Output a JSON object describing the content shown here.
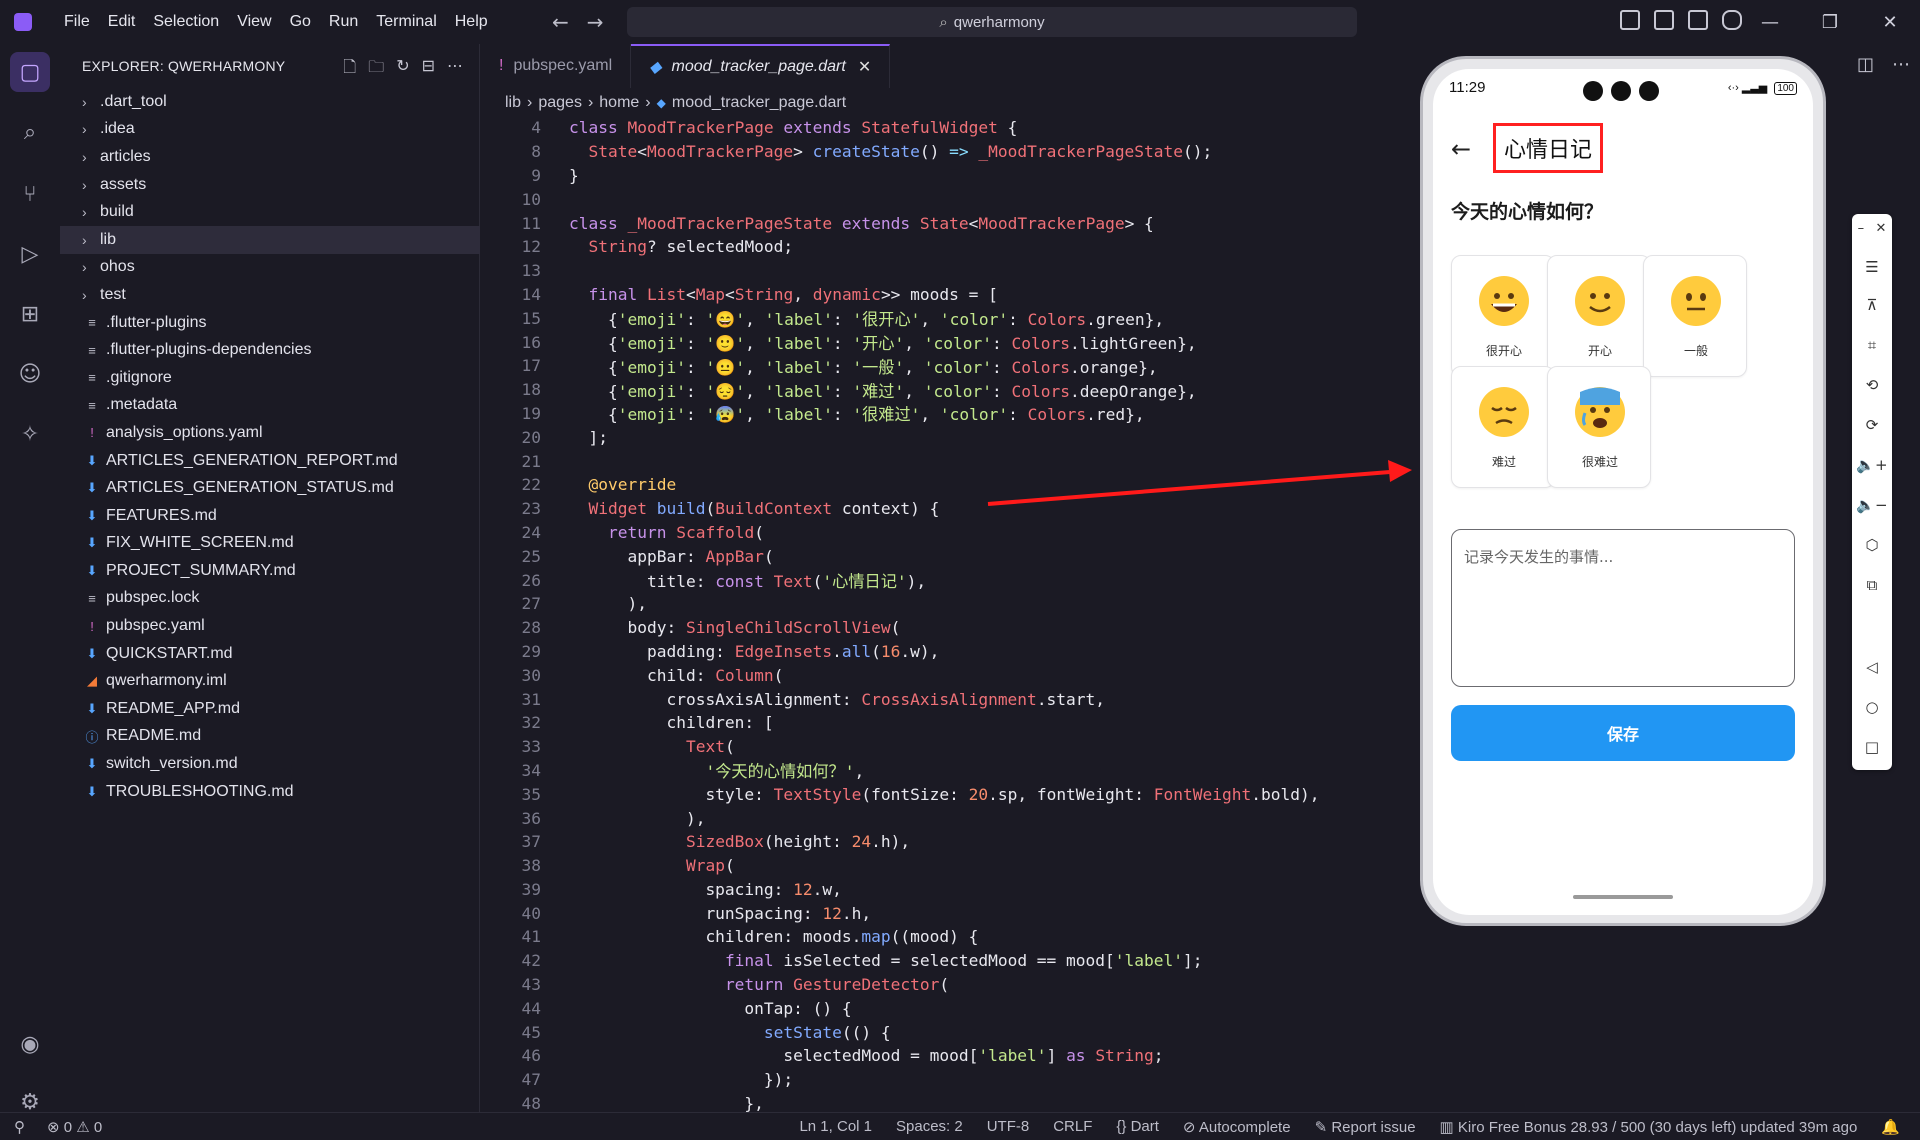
{
  "menu": [
    "File",
    "Edit",
    "Selection",
    "View",
    "Go",
    "Run",
    "Terminal",
    "Help"
  ],
  "search": {
    "label": "qwerharmony"
  },
  "explorer": {
    "title": "EXPLORER: QWERHARMONY",
    "items": [
      {
        "label": ".dart_tool",
        "kind": "folder"
      },
      {
        "label": ".idea",
        "kind": "folder"
      },
      {
        "label": "articles",
        "kind": "folder"
      },
      {
        "label": "assets",
        "kind": "folder"
      },
      {
        "label": "build",
        "kind": "folder"
      },
      {
        "label": "lib",
        "kind": "folder",
        "selected": true
      },
      {
        "label": "ohos",
        "kind": "folder"
      },
      {
        "label": "test",
        "kind": "folder"
      },
      {
        "label": ".flutter-plugins",
        "kind": "txt"
      },
      {
        "label": ".flutter-plugins-dependencies",
        "kind": "txt"
      },
      {
        "label": ".gitignore",
        "kind": "txt"
      },
      {
        "label": ".metadata",
        "kind": "txt"
      },
      {
        "label": "analysis_options.yaml",
        "kind": "yaml"
      },
      {
        "label": "ARTICLES_GENERATION_REPORT.md",
        "kind": "md"
      },
      {
        "label": "ARTICLES_GENERATION_STATUS.md",
        "kind": "md"
      },
      {
        "label": "FEATURES.md",
        "kind": "md"
      },
      {
        "label": "FIX_WHITE_SCREEN.md",
        "kind": "md"
      },
      {
        "label": "PROJECT_SUMMARY.md",
        "kind": "md"
      },
      {
        "label": "pubspec.lock",
        "kind": "txt"
      },
      {
        "label": "pubspec.yaml",
        "kind": "yaml"
      },
      {
        "label": "QUICKSTART.md",
        "kind": "md"
      },
      {
        "label": "qwerharmony.iml",
        "kind": "rss"
      },
      {
        "label": "README_APP.md",
        "kind": "md"
      },
      {
        "label": "README.md",
        "kind": "info"
      },
      {
        "label": "switch_version.md",
        "kind": "md"
      },
      {
        "label": "TROUBLESHOOTING.md",
        "kind": "md"
      }
    ]
  },
  "tabs": [
    {
      "label": "pubspec.yaml",
      "active": false
    },
    {
      "label": "mood_tracker_page.dart",
      "active": true
    }
  ],
  "breadcrumb": [
    "lib",
    "pages",
    "home",
    "mood_tracker_page.dart"
  ],
  "code": [
    {
      "n": "4",
      "html": "<span class='k'>class</span> <span class='t'>MoodTrackerPage</span> <span class='k'>extends</span> <span class='t'>StatefulWidget</span> {"
    },
    {
      "n": "8",
      "html": "  <span class='t'>State</span>&lt;<span class='t'>MoodTrackerPage</span>&gt; <span class='f'>createState</span>() <span class='p'>=&gt;</span> <span class='t'>_MoodTrackerPageState</span>();"
    },
    {
      "n": "9",
      "html": "}"
    },
    {
      "n": "10",
      "html": ""
    },
    {
      "n": "11",
      "html": "<span class='k'>class</span> <span class='t'>_MoodTrackerPageState</span> <span class='k'>extends</span> <span class='t'>State</span>&lt;<span class='t'>MoodTrackerPage</span>&gt; {"
    },
    {
      "n": "12",
      "html": "  <span class='t'>String</span>? selectedMood;"
    },
    {
      "n": "13",
      "html": ""
    },
    {
      "n": "14",
      "html": "  <span class='k'>final</span> <span class='t'>List</span>&lt;<span class='t'>Map</span>&lt;<span class='t'>String</span>, <span class='t'>dynamic</span>&gt;&gt; moods = ["
    },
    {
      "n": "15",
      "html": "    {<span class='s'>'emoji'</span>: <span class='s'>'😄'</span>, <span class='s'>'label'</span>: <span class='s'>'很开心'</span>, <span class='s'>'color'</span>: <span class='t'>Colors</span>.green},"
    },
    {
      "n": "16",
      "html": "    {<span class='s'>'emoji'</span>: <span class='s'>'🙂'</span>, <span class='s'>'label'</span>: <span class='s'>'开心'</span>, <span class='s'>'color'</span>: <span class='t'>Colors</span>.lightGreen},"
    },
    {
      "n": "17",
      "html": "    {<span class='s'>'emoji'</span>: <span class='s'>'😐'</span>, <span class='s'>'label'</span>: <span class='s'>'一般'</span>, <span class='s'>'color'</span>: <span class='t'>Colors</span>.orange},"
    },
    {
      "n": "18",
      "html": "    {<span class='s'>'emoji'</span>: <span class='s'>'😔'</span>, <span class='s'>'label'</span>: <span class='s'>'难过'</span>, <span class='s'>'color'</span>: <span class='t'>Colors</span>.deepOrange},"
    },
    {
      "n": "19",
      "html": "    {<span class='s'>'emoji'</span>: <span class='s'>'😰'</span>, <span class='s'>'label'</span>: <span class='s'>'很难过'</span>, <span class='s'>'color'</span>: <span class='t'>Colors</span>.red},"
    },
    {
      "n": "20",
      "html": "  ];"
    },
    {
      "n": "21",
      "html": ""
    },
    {
      "n": "22",
      "html": "  <span class='a'>@override</span>"
    },
    {
      "n": "23",
      "html": "  <span class='t'>Widget</span> <span class='f'>build</span>(<span class='t'>BuildContext</span> context) {"
    },
    {
      "n": "24",
      "html": "    <span class='k'>return</span> <span class='t'>Scaffold</span>("
    },
    {
      "n": "25",
      "html": "      appBar: <span class='t'>AppBar</span>("
    },
    {
      "n": "26",
      "html": "        title: <span class='k'>const</span> <span class='t'>Text</span>(<span class='s'>'心情日记'</span>),"
    },
    {
      "n": "27",
      "html": "      ),"
    },
    {
      "n": "28",
      "html": "      body: <span class='t'>SingleChildScrollView</span>("
    },
    {
      "n": "29",
      "html": "        padding: <span class='t'>EdgeInsets</span>.<span class='f'>all</span>(<span class='n'>16</span>.w),"
    },
    {
      "n": "30",
      "html": "        child: <span class='t'>Column</span>("
    },
    {
      "n": "31",
      "html": "          crossAxisAlignment: <span class='t'>CrossAxisAlignment</span>.start,"
    },
    {
      "n": "32",
      "html": "          children: ["
    },
    {
      "n": "33",
      "html": "            <span class='t'>Text</span>("
    },
    {
      "n": "34",
      "html": "              <span class='s'>'今天的心情如何？'</span>,"
    },
    {
      "n": "35",
      "html": "              style: <span class='t'>TextStyle</span>(fontSize: <span class='n'>20</span>.sp, fontWeight: <span class='t'>FontWeight</span>.bold),"
    },
    {
      "n": "36",
      "html": "            ),"
    },
    {
      "n": "37",
      "html": "            <span class='t'>SizedBox</span>(height: <span class='n'>24</span>.h),"
    },
    {
      "n": "38",
      "html": "            <span class='t'>Wrap</span>("
    },
    {
      "n": "39",
      "html": "              spacing: <span class='n'>12</span>.w,"
    },
    {
      "n": "40",
      "html": "              runSpacing: <span class='n'>12</span>.h,"
    },
    {
      "n": "41",
      "html": "              children: moods.<span class='f'>map</span>((mood) {"
    },
    {
      "n": "42",
      "html": "                <span class='k'>final</span> isSelected = selectedMood == mood[<span class='s'>'label'</span>];"
    },
    {
      "n": "43",
      "html": "                <span class='k'>return</span> <span class='t'>GestureDetector</span>("
    },
    {
      "n": "44",
      "html": "                  onTap: () {"
    },
    {
      "n": "45",
      "html": "                    <span class='f'>setState</span>(() {"
    },
    {
      "n": "46",
      "html": "                      selectedMood = mood[<span class='s'>'label'</span>] <span class='k'>as</span> <span class='t'>String</span>;"
    },
    {
      "n": "47",
      "html": "                    });"
    },
    {
      "n": "48",
      "html": "                  },"
    }
  ],
  "phone": {
    "time": "11:29",
    "battery": "100",
    "app_title": "心情日记",
    "question": "今天的心情如何？",
    "moods": [
      {
        "label": "很开心",
        "face": "grin"
      },
      {
        "label": "开心",
        "face": "smile"
      },
      {
        "label": "一般",
        "face": "neutral"
      },
      {
        "label": "难过",
        "face": "sad"
      },
      {
        "label": "很难过",
        "face": "cry"
      }
    ],
    "note_placeholder": "记录今天发生的事情...",
    "save_label": "保存"
  },
  "statusbar": {
    "errors": "0",
    "warnings": "0",
    "position": "Ln 1, Col 1",
    "spaces": "Spaces: 2",
    "encoding": "UTF-8",
    "eol": "CRLF",
    "language": "Dart",
    "autocomplete": "Autocomplete",
    "report": "Report issue",
    "bonus": "Kiro Free Bonus 28.93 / 500 (30 days left) updated 39m ago"
  },
  "colors": {
    "accent": "#8b5cf6",
    "save_button": "#2196f3",
    "highlight_box": "#ff2020",
    "arrow": "#ff1a1a"
  }
}
